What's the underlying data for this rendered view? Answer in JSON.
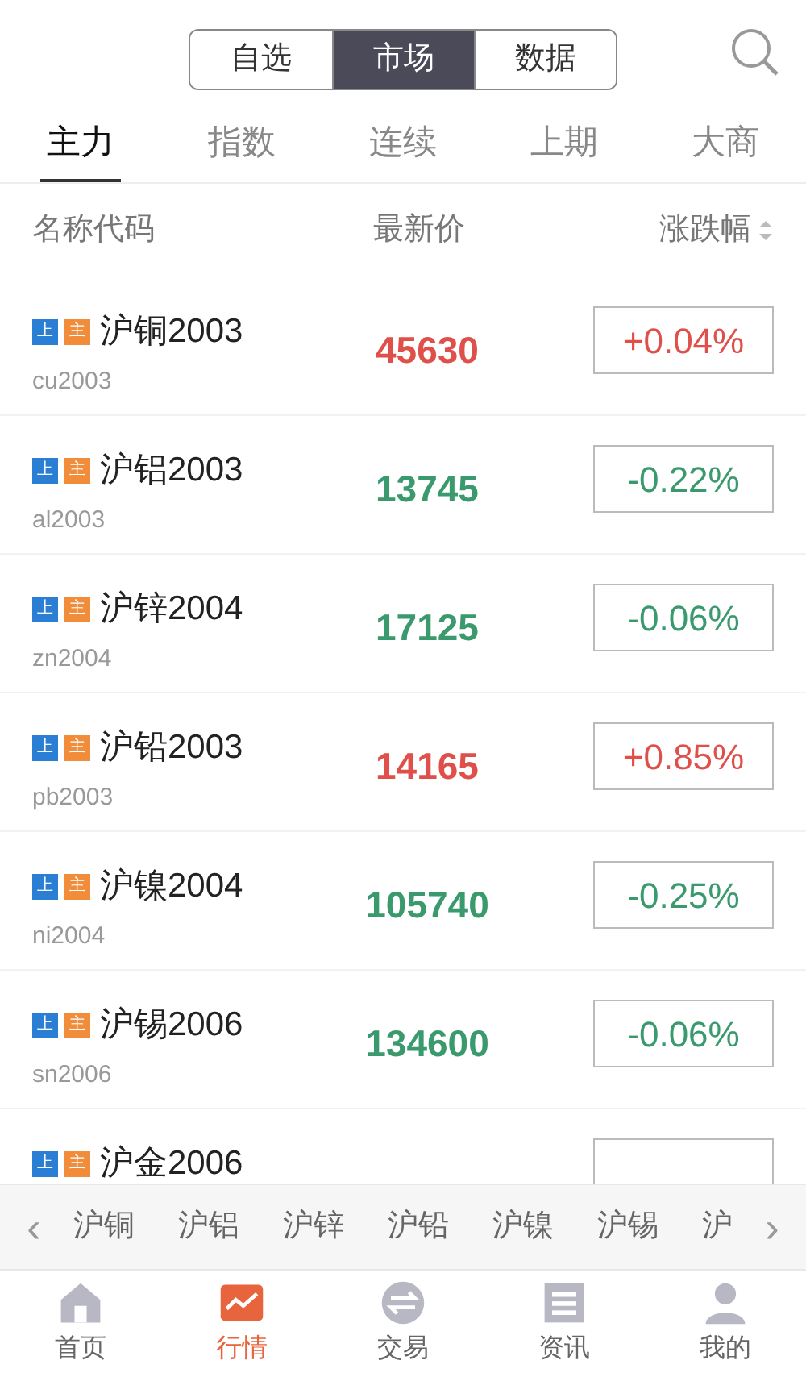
{
  "segments": [
    {
      "label": "自选",
      "selected": false
    },
    {
      "label": "市场",
      "selected": true
    },
    {
      "label": "数据",
      "selected": false
    }
  ],
  "tabs": [
    {
      "label": "主力",
      "selected": true
    },
    {
      "label": "指数",
      "selected": false
    },
    {
      "label": "连续",
      "selected": false
    },
    {
      "label": "上期",
      "selected": false
    },
    {
      "label": "大商",
      "selected": false
    }
  ],
  "columns": [
    "名称代码",
    "最新价",
    "涨跌幅"
  ],
  "rows": [
    {
      "tags": [
        "上",
        "主"
      ],
      "name": "沪铜2003",
      "code": "cu2003",
      "price": "45630",
      "change": "+0.04%",
      "color": "#e0504a"
    },
    {
      "tags": [
        "上",
        "主"
      ],
      "name": "沪铝2003",
      "code": "al2003",
      "price": "13745",
      "change": "-0.22%",
      "color": "#3a9a6e"
    },
    {
      "tags": [
        "上",
        "主"
      ],
      "name": "沪锌2004",
      "code": "zn2004",
      "price": "17125",
      "change": "-0.06%",
      "color": "#3a9a6e"
    },
    {
      "tags": [
        "上",
        "主"
      ],
      "name": "沪铅2003",
      "code": "pb2003",
      "price": "14165",
      "change": "+0.85%",
      "color": "#e0504a"
    },
    {
      "tags": [
        "上",
        "主"
      ],
      "name": "沪镍2004",
      "code": "ni2004",
      "price": "105740",
      "change": "-0.25%",
      "color": "#3a9a6e"
    },
    {
      "tags": [
        "上",
        "主"
      ],
      "name": "沪锡2006",
      "code": "sn2006",
      "price": "134600",
      "change": "-0.06%",
      "color": "#3a9a6e"
    },
    {
      "tags": [
        "上",
        "主"
      ],
      "name": "沪金2006"
    }
  ],
  "strip": {
    "prev": "‹",
    "items": [
      "沪铜",
      "沪铝",
      "沪锌",
      "沪铅",
      "沪镍",
      "沪锡",
      "沪"
    ],
    "next": "›"
  },
  "nav": [
    {
      "label": "首页",
      "kind": "home",
      "selected": false
    },
    {
      "label": "行情",
      "kind": "chart",
      "selected": true
    },
    {
      "label": "交易",
      "kind": "trade",
      "selected": false
    },
    {
      "label": "资讯",
      "kind": "news",
      "selected": false
    },
    {
      "label": "我的",
      "kind": "user",
      "selected": false
    }
  ]
}
